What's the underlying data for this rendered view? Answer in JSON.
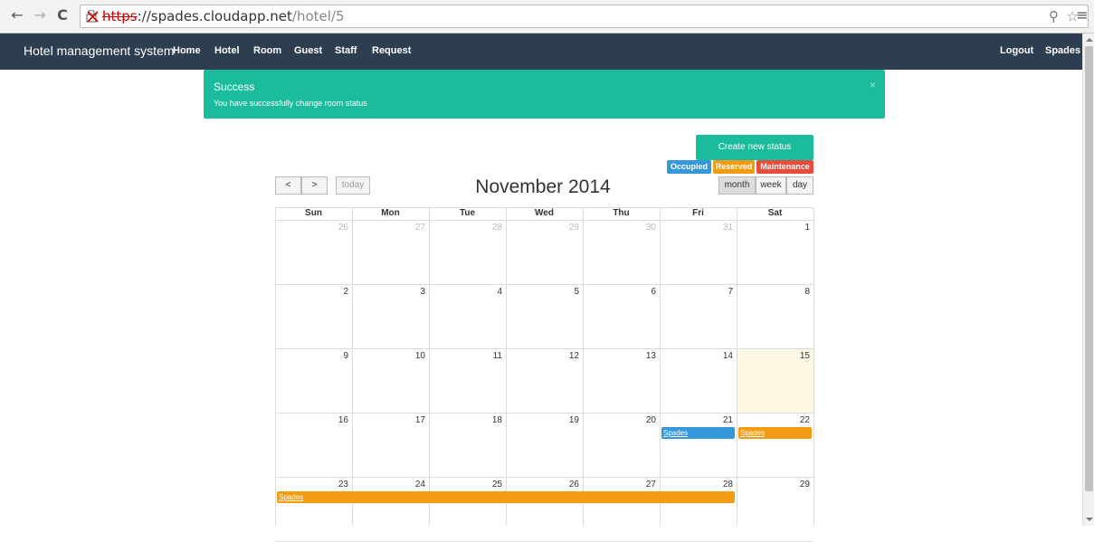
{
  "browser": {
    "url_scheme": "https",
    "url_sep": "://",
    "url_host": "spades.cloudapp.net",
    "url_path": "/hotel/5"
  },
  "navbar": {
    "brand": "Hotel management system",
    "items": [
      "Home",
      "Hotel",
      "Room",
      "Guest",
      "Staff",
      "Request"
    ],
    "logout": "Logout",
    "user": "Spades"
  },
  "alert": {
    "title": "Success",
    "message": "You have successfully change room status",
    "close": "×"
  },
  "status": {
    "create_label": "Create new status",
    "legend": [
      {
        "label": "Occupied",
        "color": "#3498db"
      },
      {
        "label": "Reserved",
        "color": "#f39c12"
      },
      {
        "label": "Maintenance",
        "color": "#e74c3c"
      }
    ]
  },
  "calendar": {
    "title": "November 2014",
    "prev": "<",
    "next": ">",
    "today": "today",
    "views": [
      "month",
      "week",
      "day"
    ],
    "active_view": "month",
    "weekdays": [
      "Sun",
      "Mon",
      "Tue",
      "Wed",
      "Thu",
      "Fri",
      "Sat"
    ],
    "weeks": [
      [
        {
          "d": "26",
          "other": true
        },
        {
          "d": "27",
          "other": true
        },
        {
          "d": "28",
          "other": true
        },
        {
          "d": "29",
          "other": true
        },
        {
          "d": "30",
          "other": true
        },
        {
          "d": "31",
          "other": true
        },
        {
          "d": "1"
        }
      ],
      [
        {
          "d": "2"
        },
        {
          "d": "3"
        },
        {
          "d": "4"
        },
        {
          "d": "5"
        },
        {
          "d": "6"
        },
        {
          "d": "7"
        },
        {
          "d": "8"
        }
      ],
      [
        {
          "d": "9"
        },
        {
          "d": "10"
        },
        {
          "d": "11"
        },
        {
          "d": "12"
        },
        {
          "d": "13"
        },
        {
          "d": "14"
        },
        {
          "d": "15",
          "today": true
        }
      ],
      [
        {
          "d": "16"
        },
        {
          "d": "17"
        },
        {
          "d": "18"
        },
        {
          "d": "19"
        },
        {
          "d": "20"
        },
        {
          "d": "21"
        },
        {
          "d": "22"
        }
      ],
      [
        {
          "d": "23"
        },
        {
          "d": "24"
        },
        {
          "d": "25"
        },
        {
          "d": "26"
        },
        {
          "d": "27"
        },
        {
          "d": "28"
        },
        {
          "d": "29"
        }
      ]
    ],
    "events": [
      {
        "title": "Spades",
        "status": "Occupied",
        "color": "#3498db",
        "week": 3,
        "start": 5,
        "end": 5
      },
      {
        "title": "Spades",
        "status": "Reserved",
        "color": "#f39c12",
        "week": 3,
        "start": 6,
        "end": 6
      },
      {
        "title": "Spades",
        "status": "Reserved",
        "color": "#f39c12",
        "week": 4,
        "start": 0,
        "end": 5
      }
    ],
    "today_bg": "#fcf8e3"
  }
}
